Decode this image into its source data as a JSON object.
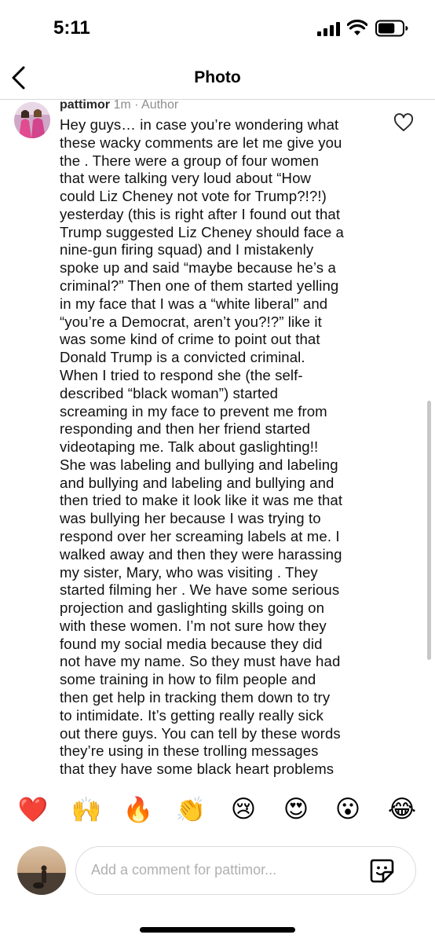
{
  "status": {
    "time": "5:11",
    "battery_level": 0.7
  },
  "nav": {
    "title": "Photo",
    "back_icon": "chevron-left-icon"
  },
  "comment": {
    "username": "pattimor",
    "age": "1m",
    "separator": "·",
    "role": "Author",
    "lines": [
      "Hey guys… in case you’re wondering what",
      "these wacky comments are let me give you",
      "the .  There were a group of four women",
      "that were talking very loud about “How",
      "could Liz Cheney not vote for Trump?!?!)",
      "yesterday (this is right after I found out that",
      "Trump suggested Liz Cheney should face a",
      "nine-gun firing squad) and I mistakenly",
      "spoke up and said “maybe because he’s a",
      "criminal?” Then one of them started yelling",
      "in my face that I was a “white liberal” and",
      "“you’re a Democrat, aren’t you?!?” like it",
      "was some kind of crime to point out that",
      "Donald Trump is a convicted criminal.",
      "When I tried to respond she (the self-",
      "described “black woman”) started",
      "screaming in my face to prevent me from",
      "responding and then her friend started",
      "videotaping me. Talk about gaslighting!!",
      "She was labeling and bullying and labeling",
      "and bullying and labeling and bullying and",
      "then tried to make it look like it was me that",
      "was bullying her because I was trying to",
      "respond over her screaming labels at me. I",
      "walked away and then they were harassing",
      "my sister, Mary, who was visiting . They",
      "started filming her . We have some serious",
      "projection and gaslighting skills going on",
      "with these women. I’m not sure how they",
      "found my social media because they did",
      "not have my name. So they must have had",
      "some training in how to film people and",
      "then get help in tracking them down to try",
      "to intimidate. It’s getting really really sick",
      "out there guys. You can tell by these words",
      "they’re using in these trolling messages",
      "that they have some black heart problems"
    ],
    "like_icon": "heart-outline-icon"
  },
  "reactions": [
    "❤️",
    "🙌",
    "🔥",
    "👏",
    "😢",
    "😍",
    "😮",
    "😂"
  ],
  "composer": {
    "placeholder": "Add a comment for pattimor...",
    "sticker_icon": "sticker-icon"
  },
  "colors": {
    "secondary_text": "#8e8e8e",
    "divider": "#d8d8d8",
    "placeholder": "#b0b0b0"
  }
}
